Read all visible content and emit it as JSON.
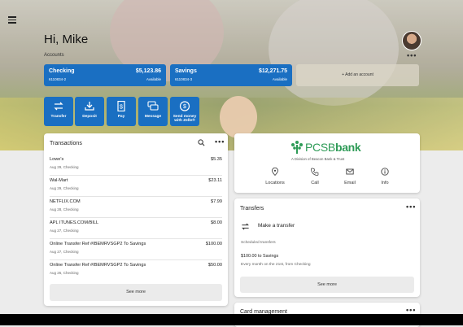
{
  "header": {
    "greeting": "Hi, Mike",
    "accounts_label": "Accounts",
    "more_label": "•••"
  },
  "accounts": [
    {
      "name": "Checking",
      "balance": "$5,123.86",
      "number": "6110834-2",
      "available": "Available"
    },
    {
      "name": "Savings",
      "balance": "$12,271.75",
      "number": "6110834-3",
      "available": "Available"
    }
  ],
  "add_account_label": "+ Add an account",
  "quick_actions": [
    {
      "label": "Transfer",
      "icon": "transfer-icon"
    },
    {
      "label": "Deposit",
      "icon": "deposit-icon"
    },
    {
      "label": "Pay",
      "icon": "pay-icon"
    },
    {
      "label": "Message",
      "icon": "message-icon"
    },
    {
      "label": "Send money with Zelle®",
      "icon": "zelle-icon"
    }
  ],
  "transactions": {
    "title": "Transactions",
    "more_label": "•••",
    "items": [
      {
        "desc": "Lowe's",
        "sub": "Aug 29, Checking",
        "amount": "$5.35"
      },
      {
        "desc": "Wal-Mart",
        "sub": "Aug 29, Checking",
        "amount": "$23.11"
      },
      {
        "desc": "NETFLIX.COM",
        "sub": "Aug 28, Checking",
        "amount": "$7.99"
      },
      {
        "desc": "APL ITUNES.COM/BILL",
        "sub": "Aug 27, Checking",
        "amount": "$8.00"
      },
      {
        "desc": "Online Transfer Ref #IBEMRVSGP2 To Savings",
        "sub": "Aug 27, Checking",
        "amount": "$100.00"
      },
      {
        "desc": "Online Transfer Ref #IBEMRVSGP2 To Savings",
        "sub": "Aug 26, Checking",
        "amount": "$50.00"
      }
    ],
    "see_more": "See more"
  },
  "bank": {
    "name_regular": "PCSB",
    "name_bold": "bank",
    "subtitle": "A Division of Beacon Bank & Trust",
    "brand_color": "#2e9b57",
    "actions": [
      {
        "label": "Locations",
        "icon": "location-icon"
      },
      {
        "label": "Call",
        "icon": "phone-icon"
      },
      {
        "label": "Email",
        "icon": "mail-icon"
      },
      {
        "label": "Info",
        "icon": "info-icon"
      }
    ]
  },
  "transfers": {
    "title": "Transfers",
    "more_label": "•••",
    "make_transfer": "Make a transfer",
    "scheduled_label": "Scheduled transfers",
    "scheduled_item": "$100.00 to Savings",
    "scheduled_detail": "Every month on the 21st, from Checking",
    "see_more": "See more"
  },
  "card_management": {
    "title": "Card management",
    "more_label": "•••"
  },
  "colors": {
    "primary": "#1a6fc2",
    "background": "#ececec"
  }
}
